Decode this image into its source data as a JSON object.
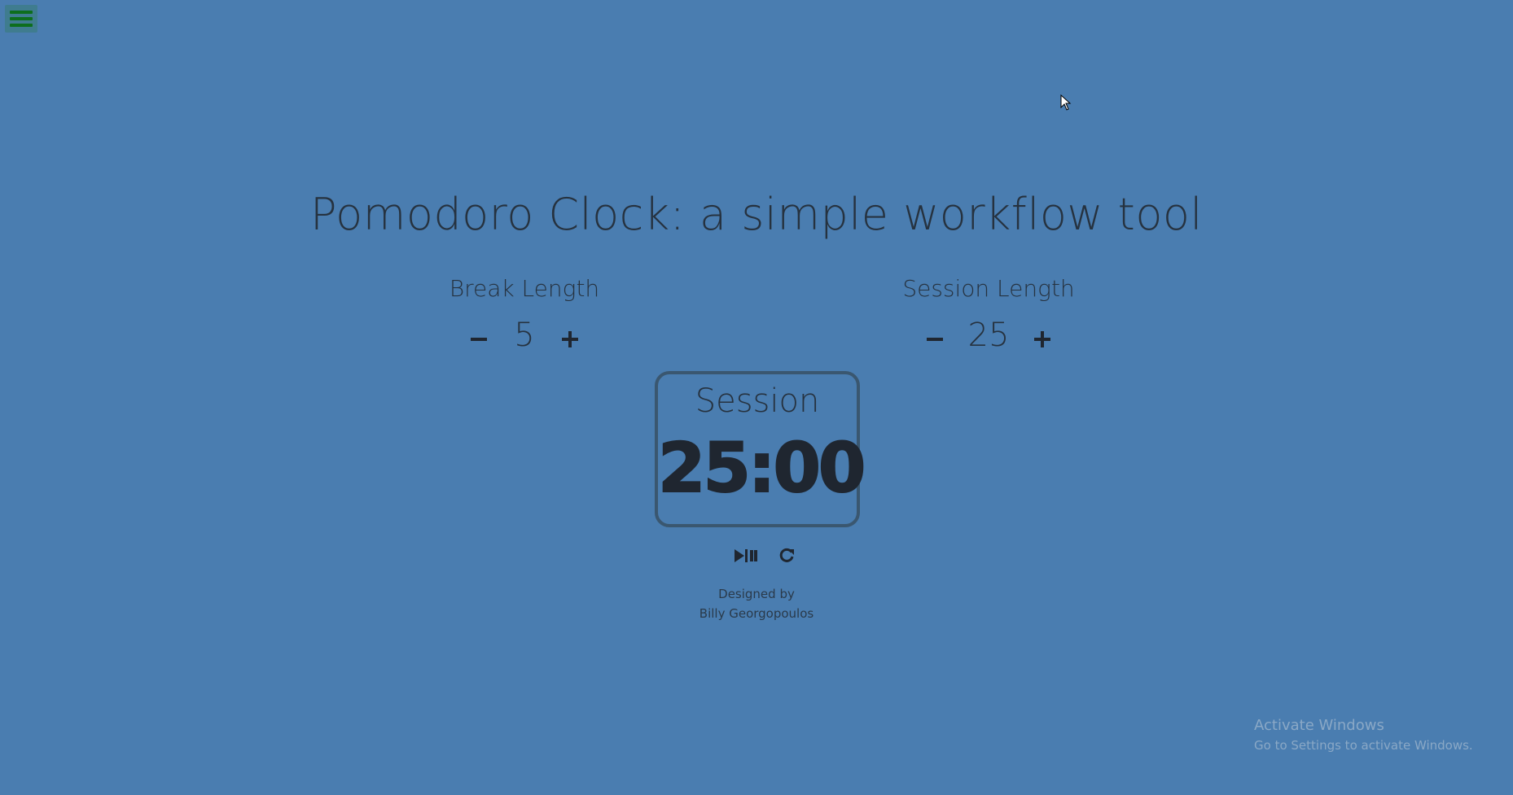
{
  "page": {
    "title": "Pomodoro Clock: a simple workflow tool"
  },
  "menu": {
    "icon": "hamburger-menu-icon"
  },
  "break": {
    "label": "Break Length",
    "value": "5",
    "decrement_icon": "minus-icon",
    "increment_icon": "plus-icon"
  },
  "session": {
    "label": "Session Length",
    "value": "25",
    "decrement_icon": "minus-icon",
    "increment_icon": "plus-icon"
  },
  "clock": {
    "mode": "Session",
    "time": "25:00"
  },
  "controls": {
    "play_pause_icon": "play-pause-icon",
    "reset_icon": "refresh-icon"
  },
  "credit": {
    "line1": "Designed by",
    "line2": "Billy Georgopoulos"
  },
  "watermark": {
    "title": "Activate Windows",
    "subtitle": "Go to Settings to activate Windows."
  },
  "colors": {
    "background": "#4a7db0",
    "text": "#26323f",
    "menu_button": "#3f7c8f",
    "menu_lines": "#0d6e1d",
    "clock_border": "#3a5770"
  }
}
